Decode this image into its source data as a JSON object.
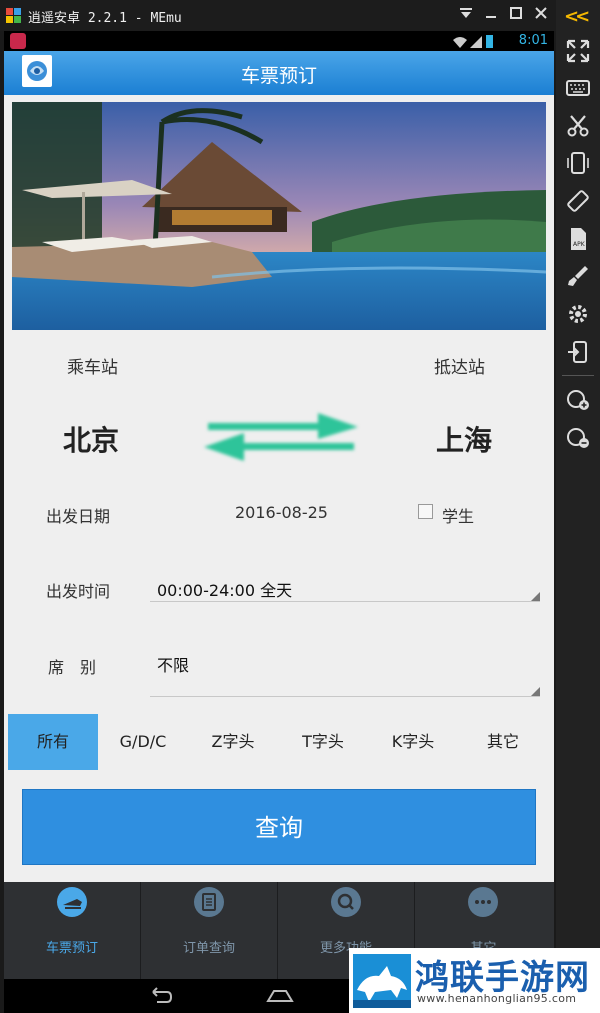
{
  "emulator": {
    "title": "逍遥安卓 2.2.1 - MEmu"
  },
  "statusbar": {
    "time": "8:01"
  },
  "header": {
    "title": "车票预订"
  },
  "stations": {
    "from_label": "乘车站",
    "to_label": "抵达站",
    "from_city": "北京",
    "to_city": "上海"
  },
  "form": {
    "date_label": "出发日期",
    "date_value": "2016-08-25",
    "student_label": "学生",
    "time_label": "出发时间",
    "time_value": "00:00-24:00 全天",
    "seat_label": "席　别",
    "seat_value": "不限"
  },
  "filters": {
    "tabs": [
      {
        "label": "所有",
        "active": true
      },
      {
        "label": "G/D/C",
        "active": false
      },
      {
        "label": "Z字头",
        "active": false
      },
      {
        "label": "T字头",
        "active": false
      },
      {
        "label": "K字头",
        "active": false
      },
      {
        "label": "其它",
        "active": false
      }
    ]
  },
  "query_button": {
    "label": "查询"
  },
  "bottom_nav": {
    "items": [
      {
        "label": "车票预订",
        "icon": "train-icon",
        "active": true
      },
      {
        "label": "订单查询",
        "icon": "order-icon",
        "active": false
      },
      {
        "label": "更多功能",
        "icon": "search-icon",
        "active": false
      },
      {
        "label": "其它",
        "icon": "more-icon",
        "active": false
      }
    ]
  },
  "watermark": {
    "name": "鸿联手游网",
    "url": "www.henanhonglian95.com"
  },
  "colors": {
    "accent": "#2f8fe0",
    "active_tab": "#4aa8e8",
    "swap_arrows": "#2fc49a",
    "toolbar_chevron": "#f5b800"
  }
}
